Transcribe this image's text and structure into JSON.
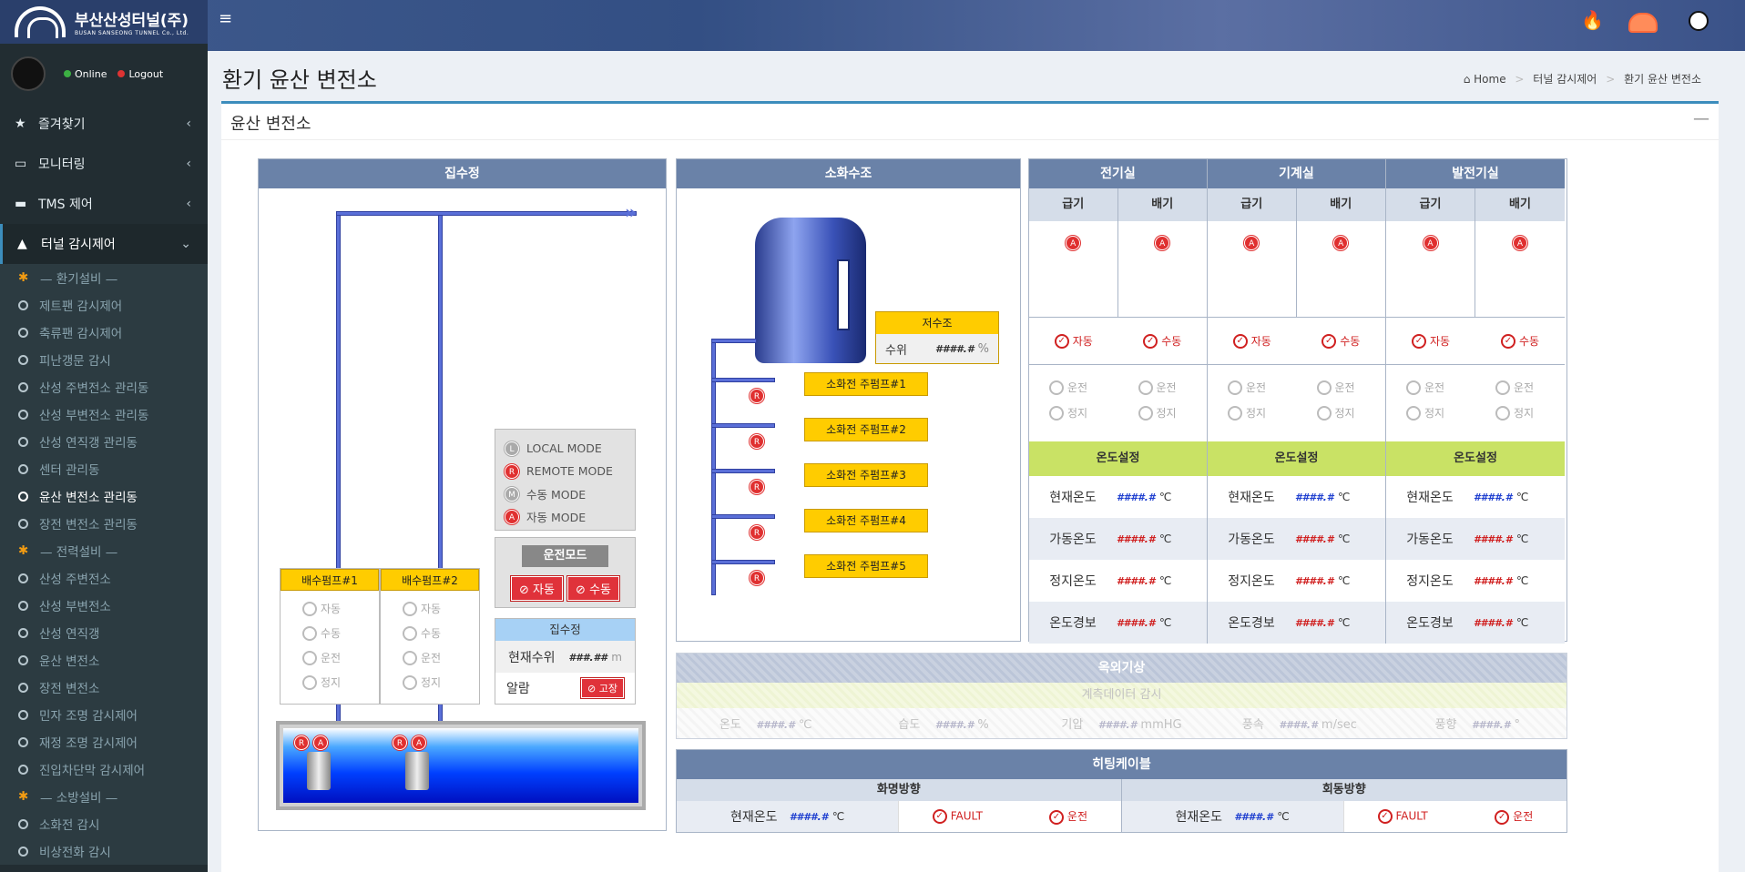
{
  "brand": {
    "name": "부산산성터널(주)",
    "sub": "BUSAN SANSEONG TUNNEL Co., Ltd."
  },
  "user": {
    "online": "Online",
    "logout": "Logout"
  },
  "menu": [
    {
      "label": "즐겨찾기",
      "icon": "star-icon"
    },
    {
      "label": "모니터링",
      "icon": "monitor-icon"
    },
    {
      "label": "TMS 제어",
      "icon": "car-icon"
    },
    {
      "label": "터널 감시제어",
      "icon": "road-icon"
    }
  ],
  "submenu": [
    {
      "label": "— 환기설비 —",
      "type": "section"
    },
    {
      "label": "제트팬 감시제어"
    },
    {
      "label": "축류팬 감시제어"
    },
    {
      "label": "피난갱문 감시"
    },
    {
      "label": "산성 주변전소 관리동"
    },
    {
      "label": "산성 부변전소 관리동"
    },
    {
      "label": "산성 연직갱 관리동"
    },
    {
      "label": "센터 관리동"
    },
    {
      "label": "윤산 변전소 관리동",
      "active": true
    },
    {
      "label": "장전 변전소 관리동"
    },
    {
      "label": "— 전력설비 —",
      "type": "section"
    },
    {
      "label": "산성 주변전소"
    },
    {
      "label": "산성 부변전소"
    },
    {
      "label": "산성 연직갱"
    },
    {
      "label": "윤산 변전소"
    },
    {
      "label": "장전 변전소"
    },
    {
      "label": "민자 조명 감시제어"
    },
    {
      "label": "재정 조명 감시제어"
    },
    {
      "label": "진입차단막 감시제어"
    },
    {
      "label": "— 소방설비 —",
      "type": "section"
    },
    {
      "label": "소화전 감시"
    },
    {
      "label": "비상전화 감시"
    }
  ],
  "page": {
    "title": "환기 윤산 변전소",
    "box_title": "윤산 변전소"
  },
  "breadcrumb": {
    "home": "Home",
    "mid": "터널 감시제어",
    "current": "환기 윤산 변전소"
  },
  "sump": {
    "title": "집수정",
    "modes": [
      "LOCAL MODE",
      "REMOTE MODE",
      "수동 MODE",
      "자동 MODE"
    ],
    "mode_letters": [
      "L",
      "R",
      "M",
      "A"
    ],
    "op_mode_label": "운전모드",
    "auto": "자동",
    "manual": "수동",
    "pump1": "배수펌프#1",
    "pump2": "배수펌프#2",
    "pump_states": [
      "자동",
      "수동",
      "운전",
      "정지"
    ],
    "level_title": "집수정",
    "level_label": "현재수위",
    "level_value": "###.##",
    "level_unit": "m",
    "alarm_label": "알람",
    "fault": "고장"
  },
  "fire": {
    "title": "소화수조",
    "tank_label": "저수조",
    "level_label": "수위",
    "level_value": "####.#",
    "level_unit": "%",
    "pumps": [
      "소화전 주펌프#1",
      "소화전 주펌프#2",
      "소화전 주펌프#3",
      "소화전 주펌프#4",
      "소화전 주펌프#5"
    ]
  },
  "rooms": {
    "names": [
      "전기실",
      "기계실",
      "발전기실"
    ],
    "sub": [
      "급기",
      "배기"
    ],
    "auto": "자동",
    "manual": "수동",
    "run": "운전",
    "stop": "정지",
    "temp_set": "온도설정",
    "rows": [
      {
        "label": "현재온도",
        "value": "####.#",
        "unit": "℃",
        "color": "blue"
      },
      {
        "label": "가동온도",
        "value": "####.#",
        "unit": "℃",
        "color": "red"
      },
      {
        "label": "정지온도",
        "value": "####.#",
        "unit": "℃",
        "color": "red"
      },
      {
        "label": "온도경보",
        "value": "####.#",
        "unit": "℃",
        "color": "red"
      }
    ]
  },
  "weather": {
    "title": "옥외기상",
    "sub": "계측데이터 감시",
    "items": [
      {
        "label": "온도",
        "value": "####.#",
        "unit": "℃"
      },
      {
        "label": "습도",
        "value": "####.#",
        "unit": "%"
      },
      {
        "label": "기압",
        "value": "####.#",
        "unit": "mmHG"
      },
      {
        "label": "풍속",
        "value": "####.#",
        "unit": "m/sec"
      },
      {
        "label": "풍향",
        "value": "####.#",
        "unit": "°"
      }
    ]
  },
  "heating": {
    "title": "히팅케이블",
    "dirs": [
      "화명방향",
      "회동방향"
    ],
    "temp_label": "현재온도",
    "value": "####.#",
    "unit": "℃",
    "fault": "FAULT",
    "run": "운전"
  }
}
